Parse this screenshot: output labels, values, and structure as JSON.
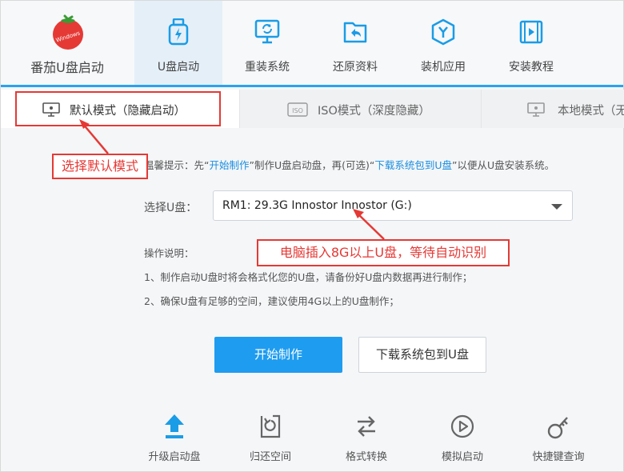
{
  "brand": {
    "name": "番茄U盘启动",
    "logo_text": "Windows",
    "logo_color": "#e53935"
  },
  "nav": {
    "items": [
      {
        "label": "U盘启动",
        "icon": "usb-flash-icon",
        "active": true
      },
      {
        "label": "重装系统",
        "icon": "monitor-refresh-icon",
        "active": false
      },
      {
        "label": "还原资料",
        "icon": "folder-restore-icon",
        "active": false
      },
      {
        "label": "装机应用",
        "icon": "hexagon-y-icon",
        "active": false
      },
      {
        "label": "安装教程",
        "icon": "video-tutorial-icon",
        "active": false
      }
    ],
    "accent_color": "#2aa2f0"
  },
  "tabs": [
    {
      "label": "默认模式（隐藏启动）",
      "icon": "monitor-icon",
      "active": true
    },
    {
      "label": "ISO模式（深度隐藏）",
      "icon": "iso-icon",
      "active": false
    },
    {
      "label": "本地模式（无",
      "icon": "monitor-icon",
      "active": false
    }
  ],
  "hint": {
    "prefix": "温馨提示：先“",
    "link1": "开始制作",
    "middle": "”制作U盘启动盘，再(可选)“",
    "link2": "下载系统包到U盘",
    "suffix": "”以便从U盘安装系统。"
  },
  "select_usb": {
    "label": "选择U盘：",
    "value": "RM1: 29.3G Innostor Innostor (G:)"
  },
  "instructions": {
    "title": "操作说明：",
    "lines": [
      "1、制作启动U盘时将会格式化您的U盘，请备份好U盘内数据再进行制作；",
      "2、确保U盘有足够的空间，建议使用4G以上的U盘制作；"
    ]
  },
  "buttons": {
    "start": "开始制作",
    "download": "下载系统包到U盘",
    "primary_color": "#1e9cf0"
  },
  "tools": [
    {
      "label": "升级启动盘",
      "icon": "upload-arrow-icon"
    },
    {
      "label": "归还空间",
      "icon": "restore-space-icon"
    },
    {
      "label": "格式转换",
      "icon": "swap-arrows-icon"
    },
    {
      "label": "模拟启动",
      "icon": "play-circle-icon"
    },
    {
      "label": "快捷键查询",
      "icon": "key-icon"
    }
  ],
  "annotations": {
    "select_mode": "选择默认模式",
    "insert_usb": "电脑插入8G以上U盘，等待自动识别",
    "color": "#e53935"
  }
}
